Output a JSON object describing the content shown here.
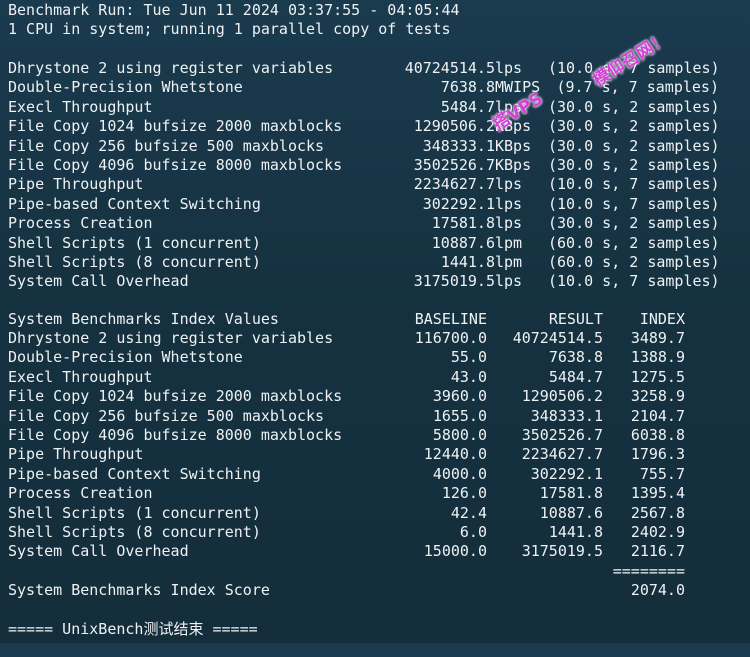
{
  "header": {
    "run_line": "Benchmark Run: Tue Jun 11 2024 03:37:55 - 04:05:44",
    "cpu_line": "1 CPU in system; running 1 parallel copy of tests"
  },
  "results": [
    {
      "name": "Dhrystone 2 using register variables",
      "value": "40724514.5",
      "unit": "lps",
      "detail": "(10.0 s, 7 samples)"
    },
    {
      "name": "Double-Precision Whetstone",
      "value": "7638.8",
      "unit": "MWIPS",
      "detail": "(9.7 s, 7 samples)"
    },
    {
      "name": "Execl Throughput",
      "value": "5484.7",
      "unit": "lps",
      "detail": "(30.0 s, 2 samples)"
    },
    {
      "name": "File Copy 1024 bufsize 2000 maxblocks",
      "value": "1290506.2",
      "unit": "KBps",
      "detail": "(30.0 s, 2 samples)"
    },
    {
      "name": "File Copy 256 bufsize 500 maxblocks",
      "value": "348333.1",
      "unit": "KBps",
      "detail": "(30.0 s, 2 samples)"
    },
    {
      "name": "File Copy 4096 bufsize 8000 maxblocks",
      "value": "3502526.7",
      "unit": "KBps",
      "detail": "(30.0 s, 2 samples)"
    },
    {
      "name": "Pipe Throughput",
      "value": "2234627.7",
      "unit": "lps",
      "detail": "(10.0 s, 7 samples)"
    },
    {
      "name": "Pipe-based Context Switching",
      "value": "302292.1",
      "unit": "lps",
      "detail": "(10.0 s, 7 samples)"
    },
    {
      "name": "Process Creation",
      "value": "17581.8",
      "unit": "lps",
      "detail": "(30.0 s, 2 samples)"
    },
    {
      "name": "Shell Scripts (1 concurrent)",
      "value": "10887.6",
      "unit": "lpm",
      "detail": "(60.0 s, 2 samples)"
    },
    {
      "name": "Shell Scripts (8 concurrent)",
      "value": "1441.8",
      "unit": "lpm",
      "detail": "(60.0 s, 2 samples)"
    },
    {
      "name": "System Call Overhead",
      "value": "3175019.5",
      "unit": "lps",
      "detail": "(10.0 s, 7 samples)"
    }
  ],
  "index_table": {
    "title": "System Benchmarks Index Values",
    "col_baseline": "BASELINE",
    "col_result": "RESULT",
    "col_index": "INDEX",
    "rows": [
      {
        "name": "Dhrystone 2 using register variables",
        "baseline": "116700.0",
        "result": "40724514.5",
        "index": "3489.7"
      },
      {
        "name": "Double-Precision Whetstone",
        "baseline": "55.0",
        "result": "7638.8",
        "index": "1388.9"
      },
      {
        "name": "Execl Throughput",
        "baseline": "43.0",
        "result": "5484.7",
        "index": "1275.5"
      },
      {
        "name": "File Copy 1024 bufsize 2000 maxblocks",
        "baseline": "3960.0",
        "result": "1290506.2",
        "index": "3258.9"
      },
      {
        "name": "File Copy 256 bufsize 500 maxblocks",
        "baseline": "1655.0",
        "result": "348333.1",
        "index": "2104.7"
      },
      {
        "name": "File Copy 4096 bufsize 8000 maxblocks",
        "baseline": "5800.0",
        "result": "3502526.7",
        "index": "6038.8"
      },
      {
        "name": "Pipe Throughput",
        "baseline": "12440.0",
        "result": "2234627.7",
        "index": "1796.3"
      },
      {
        "name": "Pipe-based Context Switching",
        "baseline": "4000.0",
        "result": "302292.1",
        "index": "755.7"
      },
      {
        "name": "Process Creation",
        "baseline": "126.0",
        "result": "17581.8",
        "index": "1395.4"
      },
      {
        "name": "Shell Scripts (1 concurrent)",
        "baseline": "42.4",
        "result": "10887.6",
        "index": "2567.8"
      },
      {
        "name": "Shell Scripts (8 concurrent)",
        "baseline": "6.0",
        "result": "1441.8",
        "index": "2402.9"
      },
      {
        "name": "System Call Overhead",
        "baseline": "15000.0",
        "result": "3175019.5",
        "index": "2116.7"
      }
    ],
    "separator": "========",
    "score_label": "System Benchmarks Index Score",
    "score_value": "2074.0"
  },
  "footer": "===== UnixBench测试结束 =====",
  "watermark": {
    "text_left": "搭VPS",
    "text_right": "模仰召网！"
  }
}
